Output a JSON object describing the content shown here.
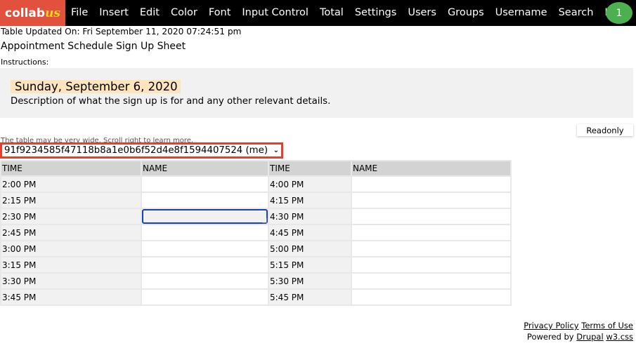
{
  "app": {
    "logo_main": "collab",
    "logo_accent": "us",
    "menu": [
      "File",
      "Insert",
      "Edit",
      "Color",
      "Font",
      "Input Control",
      "Total",
      "Settings",
      "Users",
      "Groups",
      "Username",
      "Search",
      "Help"
    ],
    "user_badge": "1"
  },
  "page": {
    "updated": "Table Updated On: Fri September 11, 2020 07:24:51 pm",
    "title": "Appointment Schedule Sign Up Sheet",
    "instructions_label": "Instructions:",
    "date": "Sunday, September 6, 2020",
    "description": "Description of what the sign up is for and any other relevant details.",
    "readonly_label": "Readonly",
    "scroll_note": "The table may be very wide. Scroll right to learn more.",
    "user_select": "91f9234585f47118b8a1e0b6f52d4e8f1594407524 (me)"
  },
  "table": {
    "headers": [
      "TIME",
      "NAME",
      "TIME",
      "NAME"
    ],
    "rows": [
      {
        "time1": "2:00 PM",
        "name1": "",
        "time2": "4:00 PM",
        "name2": ""
      },
      {
        "time1": "2:15 PM",
        "name1": "",
        "time2": "4:15 PM",
        "name2": ""
      },
      {
        "time1": "2:30 PM",
        "name1": "",
        "time2": "4:30 PM",
        "name2": ""
      },
      {
        "time1": "2:45 PM",
        "name1": "",
        "time2": "4:45 PM",
        "name2": ""
      },
      {
        "time1": "3:00 PM",
        "name1": "",
        "time2": "5:00 PM",
        "name2": ""
      },
      {
        "time1": "3:15 PM",
        "name1": "",
        "time2": "5:15 PM",
        "name2": ""
      },
      {
        "time1": "3:30 PM",
        "name1": "",
        "time2": "5:30 PM",
        "name2": ""
      },
      {
        "time1": "3:45 PM",
        "name1": "",
        "time2": "5:45 PM",
        "name2": ""
      }
    ],
    "active_cell": {
      "row": 2,
      "col": "name1"
    }
  },
  "footer": {
    "privacy": "Privacy Policy",
    "terms": "Terms of Use",
    "powered_by": "Powered by",
    "drupal": "Drupal",
    "w3css": "w3.css"
  }
}
